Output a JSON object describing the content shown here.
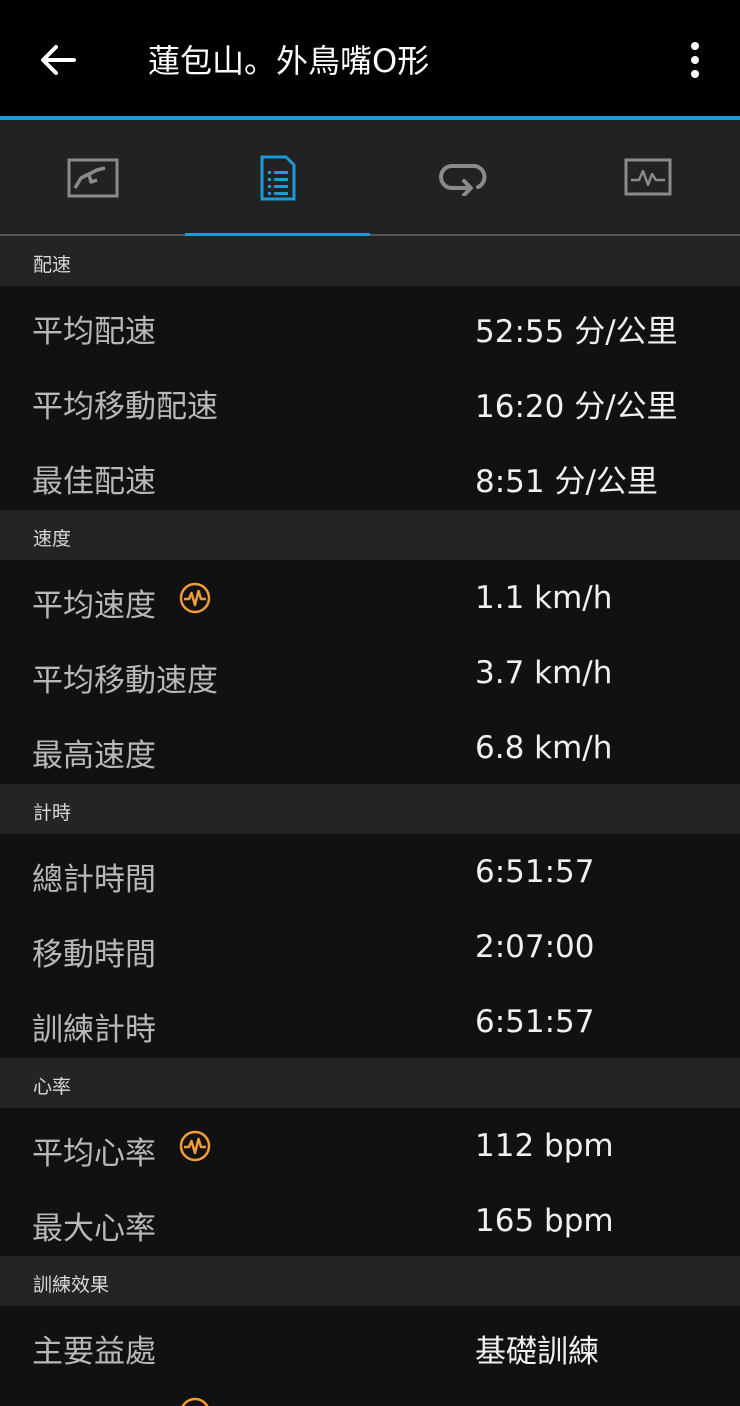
{
  "header": {
    "title": "蓮包山。外鳥嘴O形",
    "back_icon": "arrow-left-icon",
    "more_icon": "more-vertical-icon"
  },
  "tabs": [
    {
      "icon": "map-icon",
      "selected": false
    },
    {
      "icon": "stats-list-icon",
      "selected": true
    },
    {
      "icon": "laps-icon",
      "selected": false
    },
    {
      "icon": "charts-icon",
      "selected": false
    }
  ],
  "colors": {
    "accent": "#1a9ad8",
    "badge": "#f39c34",
    "background": "#111111",
    "section_bg": "#242424"
  },
  "sections": {
    "pace": {
      "title": "配速",
      "rows": [
        {
          "label": "平均配速",
          "value": "52:55 分/公里"
        },
        {
          "label": "平均移動配速",
          "value": "16:20 分/公里"
        },
        {
          "label": "最佳配速",
          "value": "8:51 分/公里"
        }
      ]
    },
    "speed": {
      "title": "速度",
      "rows": [
        {
          "label": "平均速度",
          "value": "1.1 km/h"
        },
        {
          "label": "平均移動速度",
          "value": "3.7 km/h"
        },
        {
          "label": "最高速度",
          "value": "6.8 km/h"
        }
      ]
    },
    "timing": {
      "title": "計時",
      "rows": [
        {
          "label": "總計時間",
          "value": "6:51:57"
        },
        {
          "label": "移動時間",
          "value": "2:07:00"
        },
        {
          "label": "訓練計時",
          "value": "6:51:57"
        }
      ]
    },
    "heart_rate": {
      "title": "心率",
      "rows": [
        {
          "label": "平均心率",
          "value": "112 bpm"
        },
        {
          "label": "最大心率",
          "value": "165 bpm"
        }
      ]
    },
    "training_effect": {
      "title": "訓練效果",
      "rows": [
        {
          "label": "主要益處",
          "value": "基礎訓練"
        }
      ]
    }
  }
}
